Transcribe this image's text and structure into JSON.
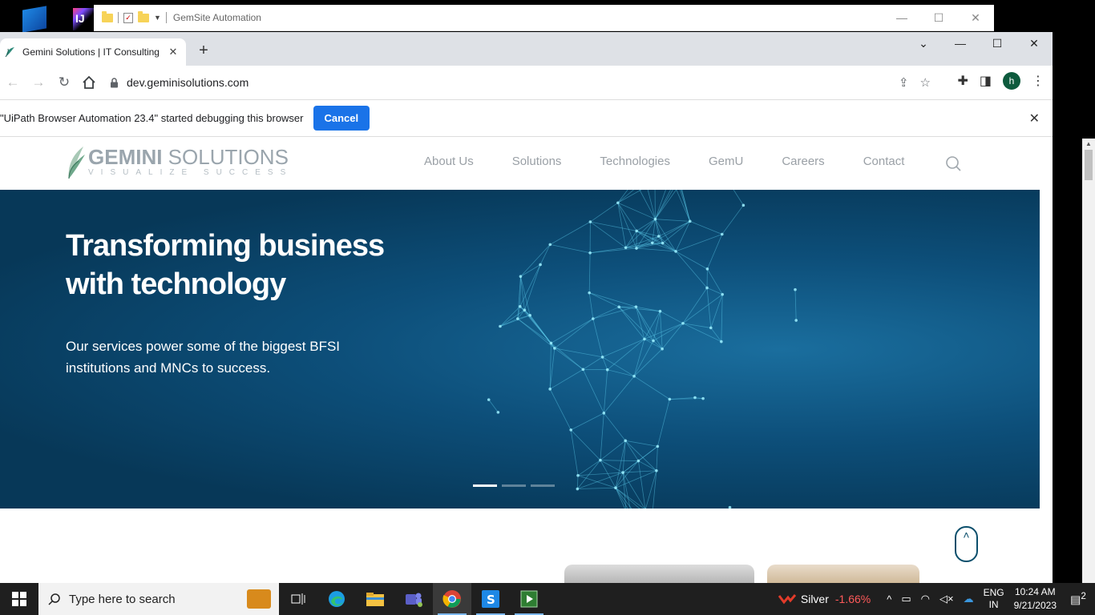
{
  "background_window": {
    "title": "GemSite Automation",
    "minimize": "—",
    "maximize": "☐",
    "close": "✕",
    "app_ij": "IJ"
  },
  "browser": {
    "tab": {
      "title": "Gemini Solutions | IT Consulting",
      "close": "✕"
    },
    "new_tab": "+",
    "controls": {
      "tab_search": "⌄",
      "minimize": "—",
      "maximize": "☐",
      "close": "✕"
    },
    "url": "dev.geminisolutions.com",
    "profile_initial": "h",
    "infobar": {
      "message": "\"UiPath Browser Automation 23.4\" started debugging this browser",
      "cancel_label": "Cancel",
      "close": "✕"
    }
  },
  "site": {
    "logo": {
      "brand_bold": "GEMINI",
      "brand_rest": " SOLUTIONS",
      "tagline": "VISUALIZE SUCCESS"
    },
    "nav": [
      "About Us",
      "Solutions",
      "Technologies",
      "GemU",
      "Careers",
      "Contact"
    ],
    "hero": {
      "headline": "Transforming business with technology",
      "subtext": "Our services power some of the biggest BFSI institutions and MNCs to success.",
      "slides": 3,
      "active_slide": 1
    },
    "scroll_top_label": "˄"
  },
  "taskbar": {
    "search_placeholder": "Type here to search",
    "stock": {
      "name": "Silver",
      "change": "-1.66%"
    },
    "lang": {
      "line1": "ENG",
      "line2": "IN"
    },
    "clock": {
      "time": "10:24 AM",
      "date": "9/21/2023"
    },
    "notifications": "2"
  },
  "colors": {
    "accent": "#1a73e8",
    "hero": "#0d4f7a",
    "stock_negative": "#ff5a5a"
  }
}
